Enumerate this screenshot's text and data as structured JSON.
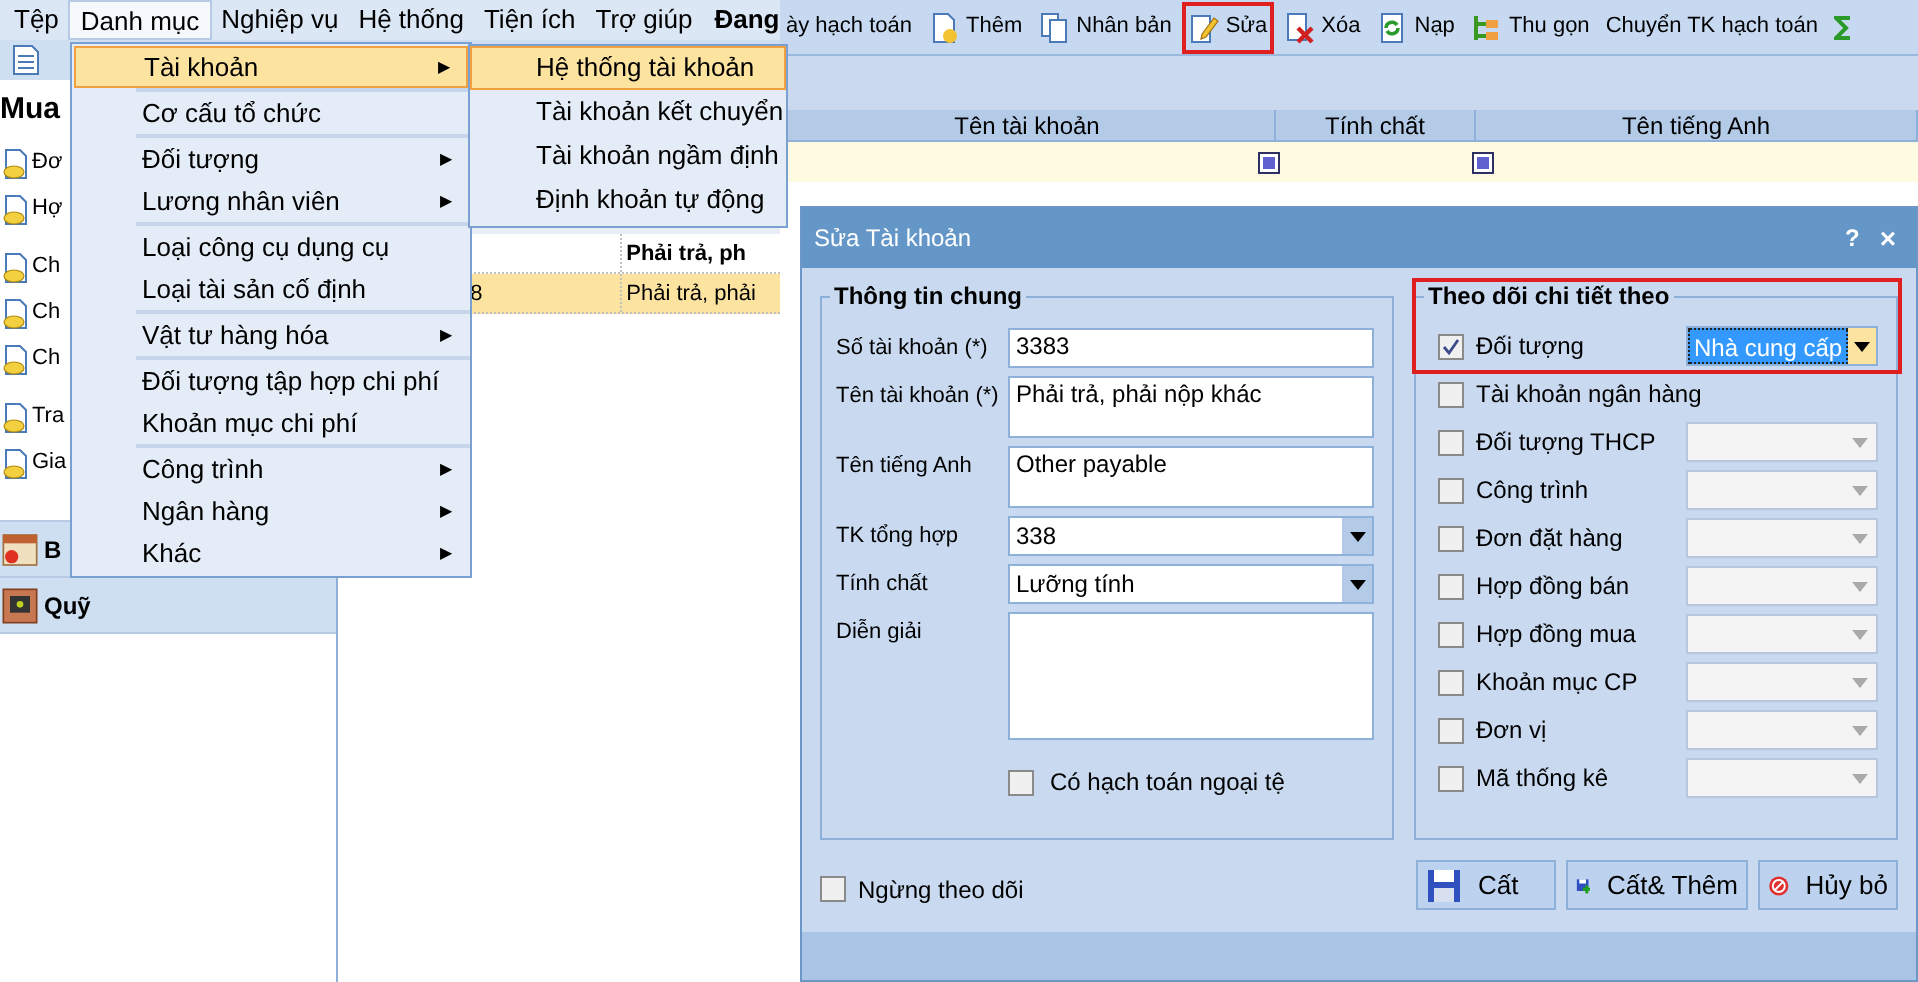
{
  "menu_bar": [
    {
      "label": "Tệp",
      "selected": false
    },
    {
      "label": "Danh mục",
      "selected": true
    },
    {
      "label": "Nghiệp vụ",
      "selected": false
    },
    {
      "label": "Hệ thống",
      "selected": false
    },
    {
      "label": "Tiện ích",
      "selected": false
    },
    {
      "label": "Trợ giúp",
      "selected": false
    }
  ],
  "menu_bar_status": "Đang",
  "toolbar": [
    {
      "label": "ày hạch toán",
      "kind": "text",
      "highlighted": false
    },
    {
      "label": "Thêm",
      "kind": "add",
      "highlighted": false
    },
    {
      "label": "Nhân bản",
      "kind": "copy",
      "highlighted": false
    },
    {
      "label": "Sửa",
      "kind": "edit",
      "highlighted": true
    },
    {
      "label": "Xóa",
      "kind": "delete",
      "highlighted": false
    },
    {
      "label": "Nạp",
      "kind": "refresh",
      "highlighted": false
    },
    {
      "label": "Thu gọn",
      "kind": "tree",
      "highlighted": false
    },
    {
      "label": "Chuyển TK hạch toán",
      "kind": "text",
      "highlighted": false
    },
    {
      "kind": "sum",
      "highlighted": false
    }
  ],
  "sidebar": {
    "title": "Mua",
    "items": [
      "Đơ",
      "Hợ",
      "Ch",
      "Ch",
      "Ch",
      "Tra",
      "Gia"
    ],
    "sections": [
      {
        "label": "B",
        "kind": "calendar"
      },
      {
        "label": "Quỹ",
        "kind": "safe"
      }
    ]
  },
  "grid": {
    "columns": [
      "Tên tài khoản",
      "Tính chất",
      "Tên tiếng Anh"
    ],
    "rows": [
      {
        "cells": [
          "",
          "Phải trả, ph"
        ],
        "bold": true,
        "selected": false
      },
      {
        "cells": [
          "8",
          "Phải trả, phải"
        ],
        "bold": false,
        "selected": true
      }
    ]
  },
  "dropdown_menu": {
    "groups": [
      [
        {
          "label": "Tài khoản",
          "submenu": true,
          "selected": true
        }
      ],
      [
        {
          "label": "Cơ cấu tổ chức",
          "submenu": false,
          "selected": false
        }
      ],
      [
        {
          "label": "Đối tượng",
          "submenu": true,
          "selected": false
        },
        {
          "label": "Lương nhân viên",
          "submenu": true,
          "selected": false
        }
      ],
      [
        {
          "label": "Loại công cụ dụng cụ",
          "submenu": false,
          "selected": false
        },
        {
          "label": "Loại tài sản cố định",
          "submenu": false,
          "selected": false
        }
      ],
      [
        {
          "label": "Vật tư hàng hóa",
          "submenu": true,
          "selected": false
        }
      ],
      [
        {
          "label": "Đối tượng tập hợp chi phí",
          "submenu": false,
          "selected": false
        },
        {
          "label": "Khoản mục chi phí",
          "submenu": false,
          "selected": false
        }
      ],
      [
        {
          "label": "Công trình",
          "submenu": true,
          "selected": false
        },
        {
          "label": "Ngân hàng",
          "submenu": true,
          "selected": false
        },
        {
          "label": "Khác",
          "submenu": true,
          "selected": false
        }
      ]
    ],
    "arrow": "▶"
  },
  "submenu": [
    {
      "label": "Hệ thống tài khoản",
      "selected": true
    },
    {
      "label": "Tài khoản kết chuyển",
      "selected": false
    },
    {
      "label": "Tài khoản ngầm định",
      "selected": false
    },
    {
      "label": "Định khoản tự động",
      "selected": false
    }
  ],
  "dialog": {
    "title": "Sửa Tài khoản",
    "help": "?",
    "close": "×",
    "general": {
      "title": "Thông tin chung",
      "fields": [
        {
          "label": "Số tài khoản (*)",
          "kind": "text",
          "value": "3383"
        },
        {
          "label": "Tên tài khoản (*)",
          "kind": "textarea",
          "value": "Phải trả, phải nộp khác"
        },
        {
          "label": "Tên tiếng Anh",
          "kind": "textarea",
          "value": "Other payable"
        },
        {
          "label": "TK tổng hợp",
          "kind": "select",
          "value": "338"
        },
        {
          "label": "Tính chất",
          "kind": "select",
          "value": "Lưỡng tính"
        },
        {
          "label": "Diễn giải",
          "kind": "memo"
        }
      ],
      "checkbox": {
        "label": "Có hạch toán ngoại tệ",
        "checked": false
      }
    },
    "tracking": {
      "title": "Theo dõi chi tiết theo",
      "highlighted": true,
      "items": [
        {
          "label": "Đối tượng",
          "checked": true,
          "kind": "select",
          "value": "Nhà cung cấp"
        },
        {
          "label": "Tài khoản ngân hàng",
          "checked": false,
          "kind": "plain"
        },
        {
          "label": "Đối tượng THCP",
          "checked": false,
          "kind": "select"
        },
        {
          "label": "Công trình",
          "checked": false,
          "kind": "select"
        },
        {
          "label": "Đơn đặt hàng",
          "checked": false,
          "kind": "select"
        },
        {
          "label": "Hợp đồng bán",
          "checked": false,
          "kind": "select"
        },
        {
          "label": "Hợp đồng mua",
          "checked": false,
          "kind": "select"
        },
        {
          "label": "Khoản mục CP",
          "checked": false,
          "kind": "select"
        },
        {
          "label": "Đơn vị",
          "checked": false,
          "kind": "select"
        },
        {
          "label": "Mã thống kê",
          "checked": false,
          "kind": "select"
        }
      ]
    },
    "stop_tracking": {
      "label": "Ngừng theo dõi",
      "checked": false
    },
    "buttons": [
      {
        "label": "Cất",
        "kind": "save"
      },
      {
        "label": "Cất& Thêm",
        "kind": "save_add"
      },
      {
        "label": "Hủy bỏ",
        "kind": "cancel"
      }
    ]
  }
}
